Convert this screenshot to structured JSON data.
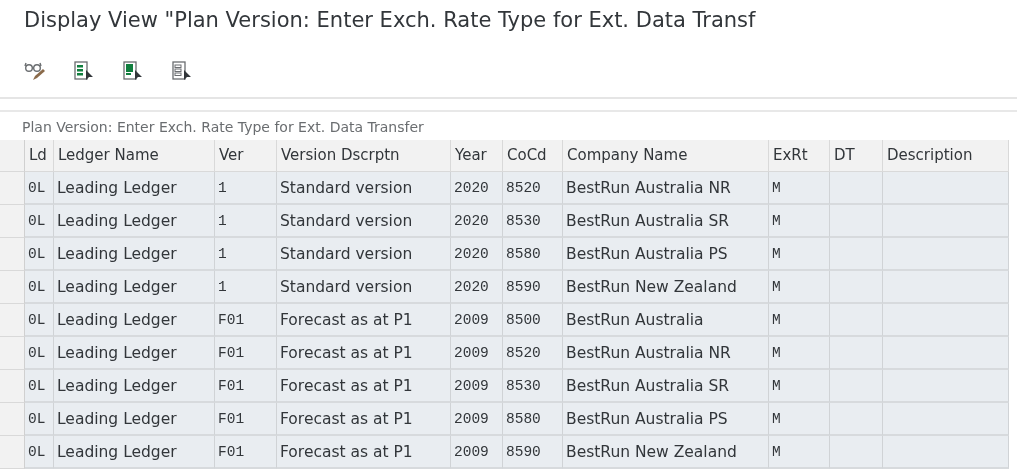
{
  "window": {
    "title": "Display View \"Plan Version: Enter Exch. Rate Type for Ext. Data Transf"
  },
  "toolbar": [
    {
      "kind": "glasses"
    },
    {
      "kind": "select-all"
    },
    {
      "kind": "select-block"
    },
    {
      "kind": "deselect-all"
    }
  ],
  "table": {
    "title": "Plan Version: Enter Exch. Rate Type for Ext. Data Transfer",
    "columns": [
      {
        "label": "Ld",
        "kind": "code"
      },
      {
        "label": "Ledger Name",
        "kind": "text"
      },
      {
        "label": "Ver",
        "kind": "code"
      },
      {
        "label": "Version Dscrptn",
        "kind": "text"
      },
      {
        "label": "Year",
        "kind": "code"
      },
      {
        "label": "CoCd",
        "kind": "code"
      },
      {
        "label": "Company Name",
        "kind": "text"
      },
      {
        "label": "ExRt",
        "kind": "code"
      },
      {
        "label": "DT",
        "kind": "code"
      },
      {
        "label": "Description",
        "kind": "text"
      }
    ],
    "rows": [
      [
        "0L",
        "Leading Ledger",
        "1",
        "Standard version",
        "2020",
        "8520",
        "BestRun Australia NR",
        "M"
      ],
      [
        "0L",
        "Leading Ledger",
        "1",
        "Standard version",
        "2020",
        "8530",
        "BestRun Australia SR",
        "M"
      ],
      [
        "0L",
        "Leading Ledger",
        "1",
        "Standard version",
        "2020",
        "8580",
        "BestRun Australia PS",
        "M"
      ],
      [
        "0L",
        "Leading Ledger",
        "1",
        "Standard version",
        "2020",
        "8590",
        "BestRun New Zealand",
        "M"
      ],
      [
        "0L",
        "Leading Ledger",
        "F01",
        "Forecast as at P1",
        "2009",
        "8500",
        "BestRun Australia",
        "M"
      ],
      [
        "0L",
        "Leading Ledger",
        "F01",
        "Forecast as at P1",
        "2009",
        "8520",
        "BestRun Australia NR",
        "M"
      ],
      [
        "0L",
        "Leading Ledger",
        "F01",
        "Forecast as at P1",
        "2009",
        "8530",
        "BestRun Australia SR",
        "M"
      ],
      [
        "0L",
        "Leading Ledger",
        "F01",
        "Forecast as at P1",
        "2009",
        "8580",
        "BestRun Australia PS",
        "M"
      ],
      [
        "0L",
        "Leading Ledger",
        "F01",
        "Forecast as at P1",
        "2009",
        "8590",
        "BestRun New Zealand",
        "M"
      ]
    ]
  }
}
